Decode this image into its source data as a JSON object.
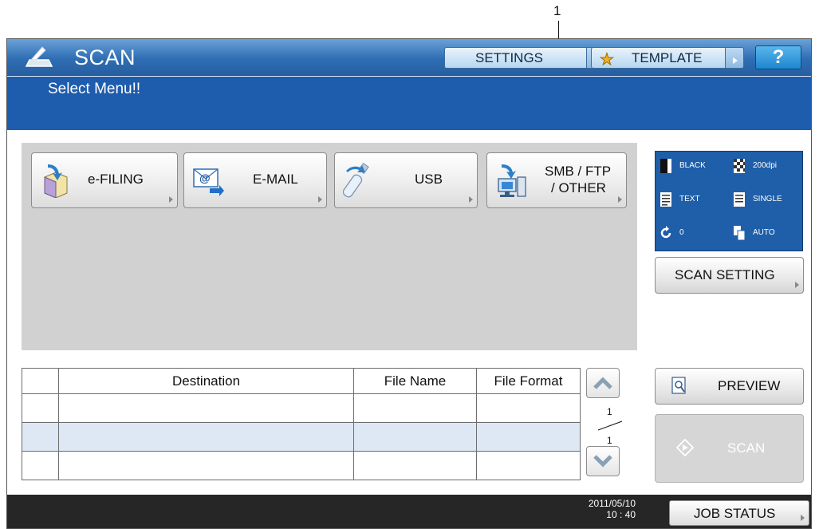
{
  "callout": {
    "number": "1"
  },
  "header": {
    "title": "SCAN",
    "settings_label": "SETTINGS",
    "template_label": "TEMPLATE",
    "help_label": "?"
  },
  "message": "Select Menu!!",
  "functions": [
    {
      "label": "e-FILING",
      "icon": "e-filing-icon"
    },
    {
      "label": "E-MAIL",
      "icon": "email-icon"
    },
    {
      "label": "USB",
      "icon": "usb-icon"
    },
    {
      "label_line1": "SMB / FTP",
      "label_line2": "/ OTHER",
      "icon": "smb-ftp-icon"
    }
  ],
  "scan_settings": {
    "color_mode": "BLACK",
    "resolution": "200dpi",
    "original_mode": "TEXT",
    "scan_sides": "SINGLE",
    "rotation": "0",
    "original_size": "AUTO",
    "button_label": "SCAN SETTING"
  },
  "table": {
    "columns": [
      "Destination",
      "File Name",
      "File Format"
    ],
    "rows": [
      [
        "",
        "",
        ""
      ],
      [
        "",
        "",
        ""
      ],
      [
        "",
        "",
        ""
      ]
    ]
  },
  "pagination": {
    "current": "1",
    "total": "1"
  },
  "actions": {
    "preview_label": "PREVIEW",
    "scan_label": "SCAN"
  },
  "status": {
    "date": "2011/05/10",
    "time": "10 : 40",
    "job_status_label": "JOB STATUS"
  },
  "colors": {
    "header_blue": "#2f6eb4",
    "message_blue": "#1e5cad",
    "bottom_bar": "#262626",
    "menu_area": "#d1d1d1"
  }
}
